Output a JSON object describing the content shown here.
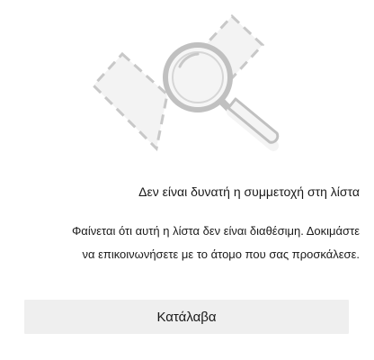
{
  "dialog": {
    "illustration_icon": "magnifier-search-icon",
    "title": "Δεν είναι δυνατή η συμμετοχή στη λίστα",
    "message_lines": [
      "Φαίνεται ότι αυτή η λίστα δεν είναι διαθέσιμη. Δοκιμάστε",
      "να επικοινωνήσετε με το άτομο που σας προσκάλεσε."
    ],
    "button_label": "Κατάλαβα"
  },
  "colors": {
    "background": "#ffffff",
    "button_background": "#efefef",
    "illustration_stroke": "#c4c4c4",
    "illustration_fill": "#f3f3f3",
    "text": "#1a1a1a"
  }
}
